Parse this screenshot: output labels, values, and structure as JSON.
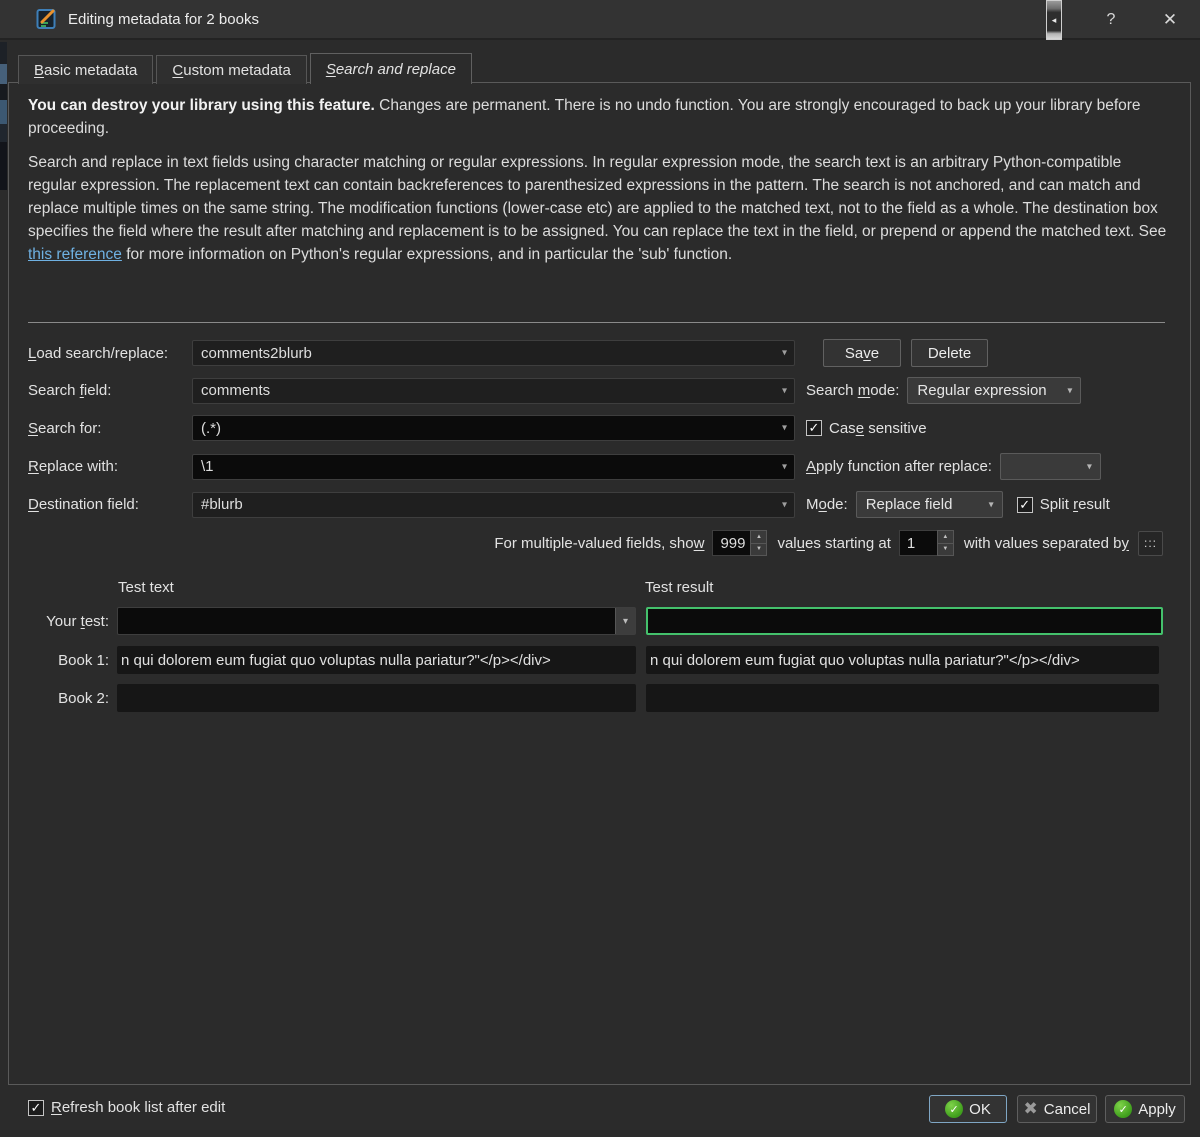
{
  "window": {
    "title": "Editing metadata for 2 books"
  },
  "icons": {
    "dropdown": "▾",
    "up": "▲",
    "down": "▼",
    "check": "✓",
    "help": "?",
    "close": "✕",
    "cancel_x": "✖",
    "back_arrow": "◂"
  },
  "tabs": [
    {
      "pre": "",
      "key": "B",
      "post": "asic metadata"
    },
    {
      "pre": "",
      "key": "C",
      "post": "ustom metadata"
    },
    {
      "pre": "",
      "key": "S",
      "post": "earch and replace"
    }
  ],
  "warning": {
    "bold": "You can destroy your library using this feature.",
    "rest": " Changes are permanent. There is no undo function. You are strongly encouraged to back up your library before proceeding."
  },
  "description": {
    "part1": "Search and replace in text fields using character matching or regular expressions. In regular expression mode, the search text is an arbitrary Python-compatible regular expression. The replacement text can contain backreferences to parenthesized expressions in the pattern. The search is not anchored, and can match and replace multiple times on the same string. The modification functions (lower-case etc) are applied to the matched text, not to the field as a whole. The destination box specifies the field where the result after matching and replacement is to be assigned. You can replace the text in the field, or prepend or append the matched text. See ",
    "link": "this reference",
    "part2": " for more information on Python's regular expressions, and in particular the 'sub' function."
  },
  "form": {
    "load_label": {
      "pre": "",
      "key": "L",
      "post": "oad search/replace:"
    },
    "load_value": "comments2blurb",
    "save_button": {
      "pre": "Sa",
      "key": "v",
      "post": "e"
    },
    "delete_button": "Delete",
    "search_field_label": {
      "pre": "Search ",
      "key": "f",
      "post": "ield:"
    },
    "search_field_value": "comments",
    "search_mode_label": {
      "pre": "Search ",
      "key": "m",
      "post": "ode:"
    },
    "search_mode_value": "Regular expression",
    "search_for_label": {
      "pre": "",
      "key": "S",
      "post": "earch for:"
    },
    "search_for_value": "(.*)",
    "case_sensitive_label": {
      "pre": "Cas",
      "key": "e",
      "post": " sensitive"
    },
    "replace_with_label": {
      "pre": "",
      "key": "R",
      "post": "eplace with:"
    },
    "replace_with_value": "\\1",
    "apply_function_label": {
      "pre": "",
      "key": "A",
      "post": "pply function after replace:"
    },
    "apply_function_value": "",
    "destination_label": {
      "pre": "",
      "key": "D",
      "post": "estination field:"
    },
    "destination_value": "#blurb",
    "mode_label": {
      "pre": "M",
      "key": "o",
      "post": "de:"
    },
    "mode_value": "Replace field",
    "split_result_label": {
      "pre": "Split ",
      "key": "r",
      "post": "esult"
    },
    "multi": {
      "show_label": {
        "pre": "For multiple-valued fields, sho",
        "key": "w",
        "post": ""
      },
      "show_value": "999",
      "starting_label": {
        "pre": "val",
        "key": "u",
        "post": "es starting at"
      },
      "starting_value": "1",
      "separator_label": {
        "pre": "with values separated b",
        "key": "y",
        "post": ""
      },
      "separator_value": ":::"
    }
  },
  "test": {
    "text_header": "Test text",
    "result_header": "Test result",
    "your_test_label": {
      "pre": "Your ",
      "key": "t",
      "post": "est:"
    },
    "your_test_value": "",
    "your_test_result": "",
    "book1_label": "Book 1:",
    "book1_text": "n qui dolorem eum fugiat quo voluptas nulla pariatur?\"</p></div>",
    "book1_result": "n qui dolorem eum fugiat quo voluptas nulla pariatur?\"</p></div>",
    "book2_label": "Book 2:",
    "book2_text": "",
    "book2_result": ""
  },
  "footer": {
    "refresh_label": {
      "pre": "",
      "key": "R",
      "post": "efresh book list after edit"
    },
    "ok_label": "OK",
    "cancel_label": "Cancel",
    "apply_label": "Apply"
  },
  "colors": {
    "accent_green": "#44c16c",
    "link_blue": "#6fb1e2",
    "dialog_bg": "#2b2b2b"
  }
}
